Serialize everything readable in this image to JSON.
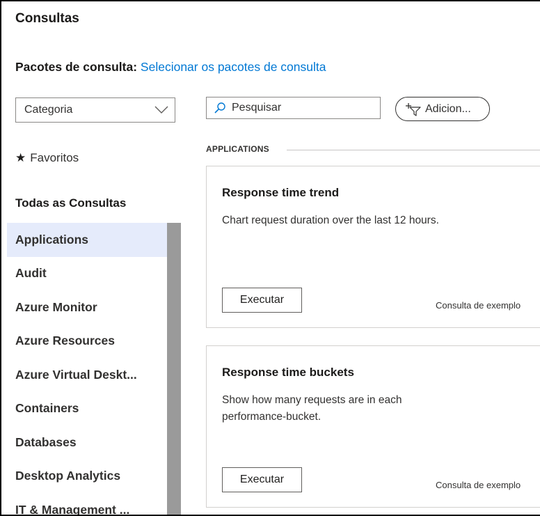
{
  "panel": {
    "title": "Consultas",
    "packs_label": "Pacotes de consulta: ",
    "packs_link": "Selecionar os pacotes de consulta"
  },
  "sidebar": {
    "category_dropdown": "Categoria",
    "favorites": "Favoritos",
    "all_queries": "Todas as Consultas",
    "items": [
      {
        "label": "Applications",
        "selected": true
      },
      {
        "label": "Audit"
      },
      {
        "label": "Azure Monitor"
      },
      {
        "label": "Azure Resources"
      },
      {
        "label": "Azure Virtual Deskt..."
      },
      {
        "label": "Containers"
      },
      {
        "label": "Databases"
      },
      {
        "label": "Desktop Analytics"
      },
      {
        "label": "IT & Management ..."
      }
    ]
  },
  "toolbar": {
    "search_placeholder": "Pesquisar",
    "add_filter_label": "Adicion..."
  },
  "main": {
    "section_title": "APPLICATIONS",
    "cards": [
      {
        "title": "Response time trend",
        "description": "Chart request duration over the last 12 hours.",
        "run_label": "Executar",
        "tag": "Consulta de exemplo"
      },
      {
        "title": "Response time buckets",
        "description": "Show how many requests are in each performance-bucket.",
        "run_label": "Executar",
        "tag": "Consulta de exemplo"
      }
    ]
  },
  "colors": {
    "link": "#0078d4",
    "selected_item_bg": "#e5ebfb",
    "scrollbar": "#9a9a9a"
  }
}
